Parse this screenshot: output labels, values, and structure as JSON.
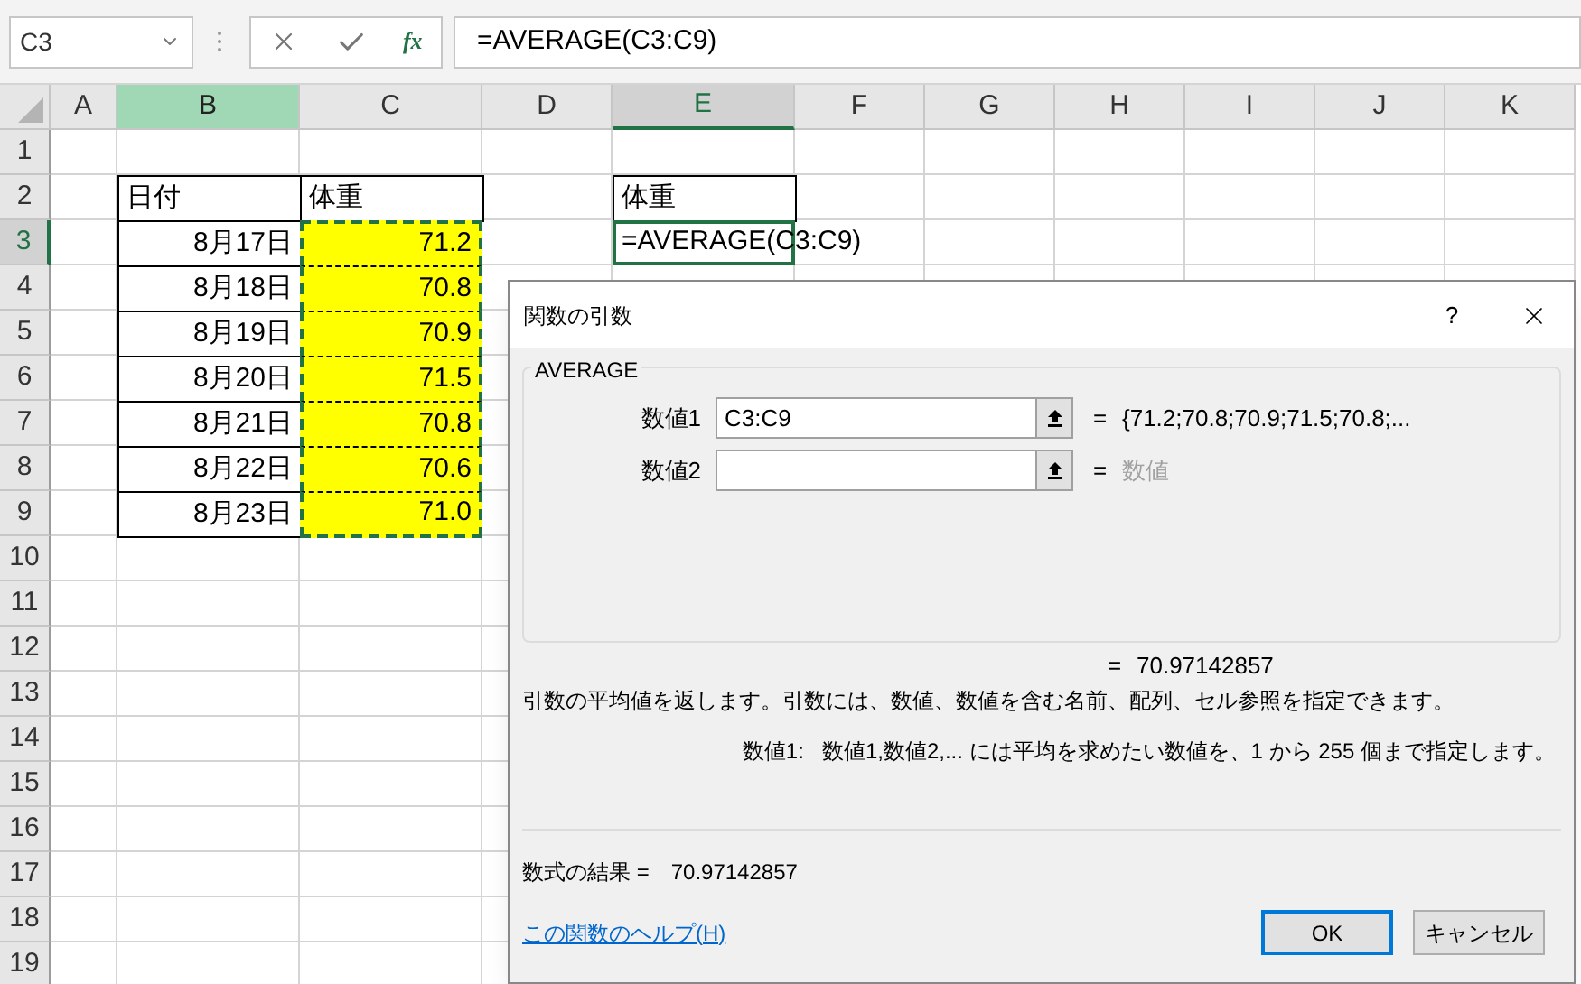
{
  "name_box": {
    "value": "C3"
  },
  "formula_bar": {
    "fx_label": "fx",
    "formula": "=AVERAGE(C3:C9)"
  },
  "columns": [
    {
      "label": "A",
      "referenced": false,
      "selected": false
    },
    {
      "label": "B",
      "referenced": true,
      "selected": false
    },
    {
      "label": "C",
      "referenced": false,
      "selected": false
    },
    {
      "label": "D",
      "referenced": false,
      "selected": false
    },
    {
      "label": "E",
      "referenced": false,
      "selected": true
    },
    {
      "label": "F",
      "referenced": false,
      "selected": false
    },
    {
      "label": "G",
      "referenced": false,
      "selected": false
    },
    {
      "label": "H",
      "referenced": false,
      "selected": false
    },
    {
      "label": "I",
      "referenced": false,
      "selected": false
    },
    {
      "label": "J",
      "referenced": false,
      "selected": false
    },
    {
      "label": "K",
      "referenced": false,
      "selected": false
    }
  ],
  "rows": [
    {
      "label": "1",
      "selected": false
    },
    {
      "label": "2",
      "selected": false
    },
    {
      "label": "3",
      "selected": true
    },
    {
      "label": "4",
      "selected": false
    },
    {
      "label": "5",
      "selected": false
    },
    {
      "label": "6",
      "selected": false
    },
    {
      "label": "7",
      "selected": false
    },
    {
      "label": "8",
      "selected": false
    },
    {
      "label": "9",
      "selected": false
    },
    {
      "label": "10",
      "selected": false
    },
    {
      "label": "11",
      "selected": false
    },
    {
      "label": "12",
      "selected": false
    },
    {
      "label": "13",
      "selected": false
    },
    {
      "label": "14",
      "selected": false
    },
    {
      "label": "15",
      "selected": false
    },
    {
      "label": "16",
      "selected": false
    },
    {
      "label": "17",
      "selected": false
    },
    {
      "label": "18",
      "selected": false
    },
    {
      "label": "19",
      "selected": false
    }
  ],
  "data_table": {
    "headers": [
      "日付",
      "体重"
    ],
    "weight_referenced": true,
    "rows": [
      {
        "date": "8月17日",
        "weight": "71.2"
      },
      {
        "date": "8月18日",
        "weight": "70.8"
      },
      {
        "date": "8月19日",
        "weight": "70.9"
      },
      {
        "date": "8月20日",
        "weight": "71.5"
      },
      {
        "date": "8月21日",
        "weight": "70.8"
      },
      {
        "date": "8月22日",
        "weight": "70.6"
      },
      {
        "date": "8月23日",
        "weight": "71.0"
      }
    ]
  },
  "result": {
    "header": "体重",
    "formula": "=AVERAGE(C3:C9)",
    "active": true
  },
  "dialog": {
    "title": "関数の引数",
    "help_glyph": "?",
    "function_name": "AVERAGE",
    "arguments": [
      {
        "label": "数値1",
        "value": "C3:C9",
        "equals": "=",
        "result": "{71.2;70.8;70.9;71.5;70.8;...",
        "dimmed": false
      },
      {
        "label": "数値2",
        "equals": "=",
        "result": "数値",
        "dimmed": true
      }
    ],
    "equals": "=",
    "result": "70.97142857",
    "description": "引数の平均値を返します。引数には、数値、数値を含む名前、配列、セル参照を指定できます。",
    "argument_help_label": "数値1:",
    "argument_help": "数値1,数値2,... には平均を求めたい数値を、1 から 255 個まで指定します。",
    "formula_result_label": "数式の結果 =",
    "formula_result": "70.97142857",
    "help_link": "この関数のヘルプ(H)",
    "buttons": [
      {
        "label": "OK",
        "default": true
      },
      {
        "label": "キャンセル",
        "default": false
      }
    ]
  }
}
